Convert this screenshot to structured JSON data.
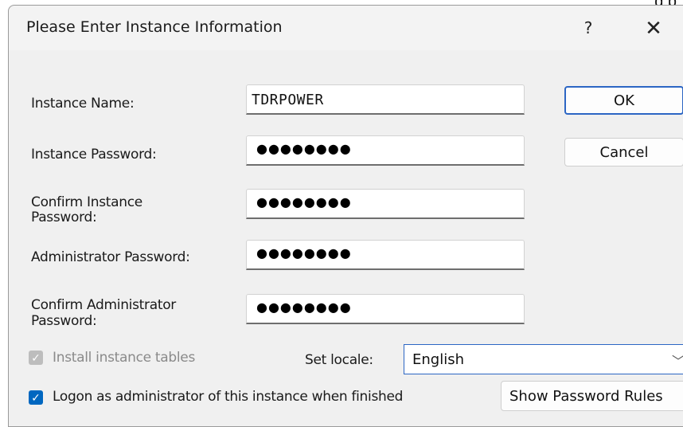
{
  "fragment": "g   p",
  "dialog": {
    "title": "Please Enter Instance Information",
    "help": "?",
    "close": "✕"
  },
  "labels": {
    "instance_name": "Instance Name:",
    "instance_password": "Instance Password:",
    "confirm_instance_1": "Confirm Instance",
    "confirm_instance_2": "Password:",
    "admin_password": "Administrator Password:",
    "confirm_admin_1": "Confirm Administrator",
    "confirm_admin_2": "Password:"
  },
  "fields": {
    "instance_name": "TDRPOWER",
    "instance_password": "●●●●●●●●",
    "confirm_instance_password": "●●●●●●●●",
    "admin_password": "●●●●●●●●",
    "confirm_admin_password": "●●●●●●●●"
  },
  "buttons": {
    "ok": "OK",
    "cancel": "Cancel",
    "show_rules": "Show Password Rules"
  },
  "options": {
    "install_tables": "Install instance tables",
    "install_tables_checked": true,
    "install_tables_disabled": true,
    "locale_label": "Set locale:",
    "locale_value": "English",
    "logon_admin": "Logon as administrator of this instance when finished",
    "logon_admin_checked": true
  },
  "colors": {
    "accent": "#0067c0",
    "dialog_bg": "#f0f0f0"
  }
}
